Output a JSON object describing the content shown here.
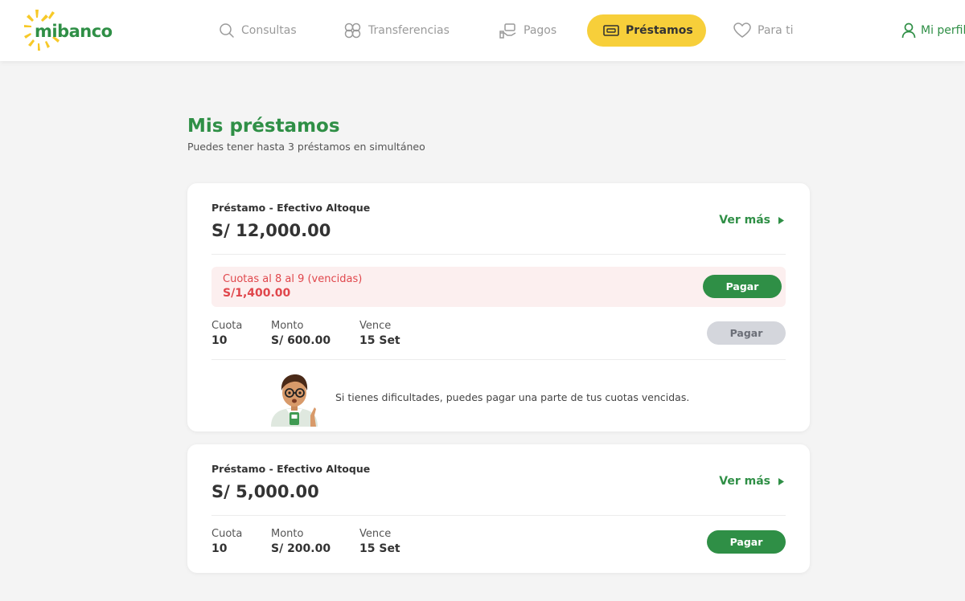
{
  "app": {
    "brand": "mibanco",
    "accent": "#2f8f46",
    "highlight": "#f7cf3a",
    "alert": "#e0474c"
  },
  "nav": {
    "items": [
      {
        "label": "Consultas",
        "icon": "search-icon"
      },
      {
        "label": "Transferencias",
        "icon": "transfer-icon"
      },
      {
        "label": "Pagos",
        "icon": "payments-icon"
      },
      {
        "label": "Préstamos",
        "icon": "loan-icon",
        "active": true
      },
      {
        "label": "Para ti",
        "icon": "heart-icon"
      }
    ],
    "profile_label": "Mi perfil"
  },
  "page": {
    "title": "Mis préstamos",
    "subtitle": "Puedes tener hasta 3 préstamos en simultáneo"
  },
  "loans": [
    {
      "name": "Préstamo - Efectivo Altoque",
      "amount": "S/ 12,000.00",
      "see_more": "Ver más",
      "overdue": {
        "label": "Cuotas al 8 al 9 (vencidas)",
        "amount": "S/1,400.00",
        "pay_label": "Pagar"
      },
      "installment": {
        "cuota_label": "Cuota",
        "cuota_value": "10",
        "monto_label": "Monto",
        "monto_value": "S/ 600.00",
        "vence_label": "Vence",
        "vence_value": "15 Set",
        "pay_label": "Pagar",
        "pay_enabled": false
      },
      "tip": "Si tienes dificultades, puedes pagar una parte de tus cuotas vencidas."
    },
    {
      "name": "Préstamo - Efectivo Altoque",
      "amount": "S/ 5,000.00",
      "see_more": "Ver más",
      "installment": {
        "cuota_label": "Cuota",
        "cuota_value": "10",
        "monto_label": "Monto",
        "monto_value": "S/ 200.00",
        "vence_label": "Vence",
        "vence_value": "15 Set",
        "pay_label": "Pagar",
        "pay_enabled": true
      }
    }
  ]
}
